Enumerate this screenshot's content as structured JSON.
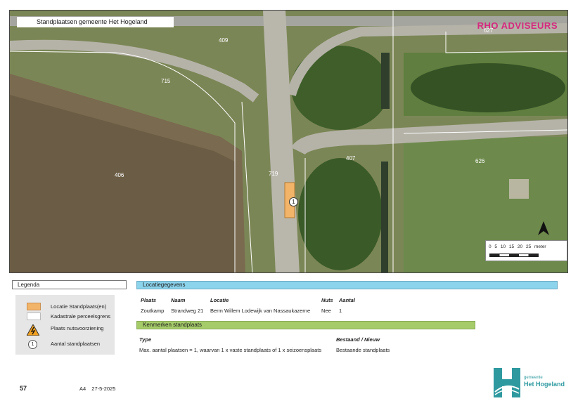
{
  "map": {
    "title": "Standplaatsen gemeente Het Hogeland",
    "brand": "RHO ADVISEURS",
    "parcels": [
      "409",
      "627",
      "715",
      "406",
      "719",
      "407",
      "626"
    ],
    "marker_count": "1",
    "scale_labels": "0 5 10 15 20 25 meter",
    "north_icon": "north-arrow-icon"
  },
  "legend": {
    "title": "Legenda",
    "items": [
      {
        "label": "Locatie Standplaats(en)",
        "color": "#f2b469"
      },
      {
        "label": "Kadastrale perceelsgrens",
        "color": "#ffffff"
      },
      {
        "label": "Plaats nutsvoorziening",
        "icon": "electricity-warning-icon"
      },
      {
        "label": "Aantal standplaatsen",
        "symbol": "1"
      }
    ]
  },
  "location": {
    "title": "Locatiegegevens",
    "headers": [
      "Plaats",
      "Naam",
      "Locatie",
      "Nuts",
      "Aantal"
    ],
    "row": [
      "Zoutkamp",
      "Strandweg 21",
      "Berm Willem Lodewijk van Nassaukazerne",
      "Nee",
      "1"
    ]
  },
  "features": {
    "title": "Kenmerken standplaats",
    "headers": [
      "Type",
      "Bestaand / Nieuw"
    ],
    "row": [
      "Max. aantal plaatsen = 1, waarvan 1 x vaste standplaats of 1 x seizoensplaats",
      "Bestaande standplaats"
    ]
  },
  "footer": {
    "page": "57",
    "format": "A4",
    "date": "27-5-2025",
    "logo_small": "gemeente",
    "logo_big": "Het Hogeland"
  },
  "colors": {
    "accent": "#d6287e",
    "location_bar": "#8cd3ec",
    "features_bar": "#a6cc6a",
    "standplaats": "#f2b469"
  }
}
